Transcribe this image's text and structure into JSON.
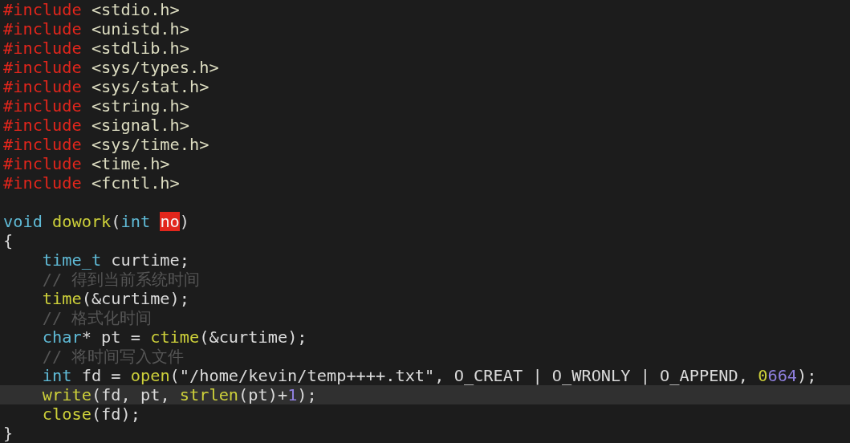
{
  "editor": {
    "lines": [
      {
        "current": false,
        "tokens": [
          {
            "text": "#include",
            "kind": "preproc"
          },
          {
            "text": " <stdio.h>",
            "kind": "header"
          }
        ]
      },
      {
        "current": false,
        "tokens": [
          {
            "text": "#include",
            "kind": "preproc"
          },
          {
            "text": " <unistd.h>",
            "kind": "header"
          }
        ]
      },
      {
        "current": false,
        "tokens": [
          {
            "text": "#include",
            "kind": "preproc"
          },
          {
            "text": " <stdlib.h>",
            "kind": "header"
          }
        ]
      },
      {
        "current": false,
        "tokens": [
          {
            "text": "#include",
            "kind": "preproc"
          },
          {
            "text": " <sys/types.h>",
            "kind": "header"
          }
        ]
      },
      {
        "current": false,
        "tokens": [
          {
            "text": "#include",
            "kind": "preproc"
          },
          {
            "text": " <sys/stat.h>",
            "kind": "header"
          }
        ]
      },
      {
        "current": false,
        "tokens": [
          {
            "text": "#include",
            "kind": "preproc"
          },
          {
            "text": " <string.h>",
            "kind": "header"
          }
        ]
      },
      {
        "current": false,
        "tokens": [
          {
            "text": "#include",
            "kind": "preproc"
          },
          {
            "text": " <signal.h>",
            "kind": "header"
          }
        ]
      },
      {
        "current": false,
        "tokens": [
          {
            "text": "#include",
            "kind": "preproc"
          },
          {
            "text": " <sys/time.h>",
            "kind": "header"
          }
        ]
      },
      {
        "current": false,
        "tokens": [
          {
            "text": "#include",
            "kind": "preproc"
          },
          {
            "text": " <time.h>",
            "kind": "header"
          }
        ]
      },
      {
        "current": false,
        "tokens": [
          {
            "text": "#include",
            "kind": "preproc"
          },
          {
            "text": " <fcntl.h>",
            "kind": "header"
          }
        ]
      },
      {
        "current": false
      },
      {
        "current": false,
        "tokens": [
          {
            "text": "void ",
            "kind": "type"
          },
          {
            "text": "dowork",
            "kind": "func"
          },
          {
            "text": "(",
            "kind": "plain"
          },
          {
            "text": "int ",
            "kind": "type"
          },
          {
            "text": "no",
            "kind": "error"
          },
          {
            "text": ")",
            "kind": "plain"
          }
        ]
      },
      {
        "current": false,
        "tokens": [
          {
            "text": "{",
            "kind": "plain"
          }
        ]
      },
      {
        "current": false,
        "tokens": [
          {
            "text": "    time_t",
            "kind": "type"
          },
          {
            "text": " curtime;",
            "kind": "plain"
          }
        ]
      },
      {
        "current": false,
        "tokens": [
          {
            "text": "    // 得到当前系统时间",
            "kind": "comment"
          }
        ]
      },
      {
        "current": false,
        "tokens": [
          {
            "text": "    time",
            "kind": "func"
          },
          {
            "text": "(&curtime);",
            "kind": "plain"
          }
        ]
      },
      {
        "current": false,
        "tokens": [
          {
            "text": "    // 格式化时间",
            "kind": "comment"
          }
        ]
      },
      {
        "current": false,
        "tokens": [
          {
            "text": "    char",
            "kind": "type"
          },
          {
            "text": "* pt = ",
            "kind": "plain"
          },
          {
            "text": "ctime",
            "kind": "func"
          },
          {
            "text": "(&curtime);",
            "kind": "plain"
          }
        ]
      },
      {
        "current": false,
        "tokens": [
          {
            "text": "    // 将时间写入文件",
            "kind": "comment"
          }
        ]
      },
      {
        "current": false,
        "tokens": [
          {
            "text": "    int",
            "kind": "type"
          },
          {
            "text": " fd = ",
            "kind": "plain"
          },
          {
            "text": "open",
            "kind": "func"
          },
          {
            "text": "(\"/home/kevin/temp++++.txt\", O_CREAT | O_WRONLY | O_APPEND, ",
            "kind": "plain"
          },
          {
            "text": "0",
            "kind": "func"
          },
          {
            "text": "664",
            "kind": "number"
          },
          {
            "text": ");",
            "kind": "plain"
          }
        ]
      },
      {
        "current": true,
        "tokens": [
          {
            "text": "    write",
            "kind": "func"
          },
          {
            "text": "(fd, pt, ",
            "kind": "plain"
          },
          {
            "text": "strlen",
            "kind": "func"
          },
          {
            "text": "(pt)+",
            "kind": "plain"
          },
          {
            "text": "1",
            "kind": "number"
          },
          {
            "text": ");",
            "kind": "plain"
          }
        ]
      },
      {
        "current": false,
        "tokens": [
          {
            "text": "    close",
            "kind": "func"
          },
          {
            "text": "(fd);",
            "kind": "plain"
          }
        ]
      },
      {
        "current": false,
        "tokens": [
          {
            "text": "}",
            "kind": "plain"
          }
        ]
      }
    ]
  }
}
